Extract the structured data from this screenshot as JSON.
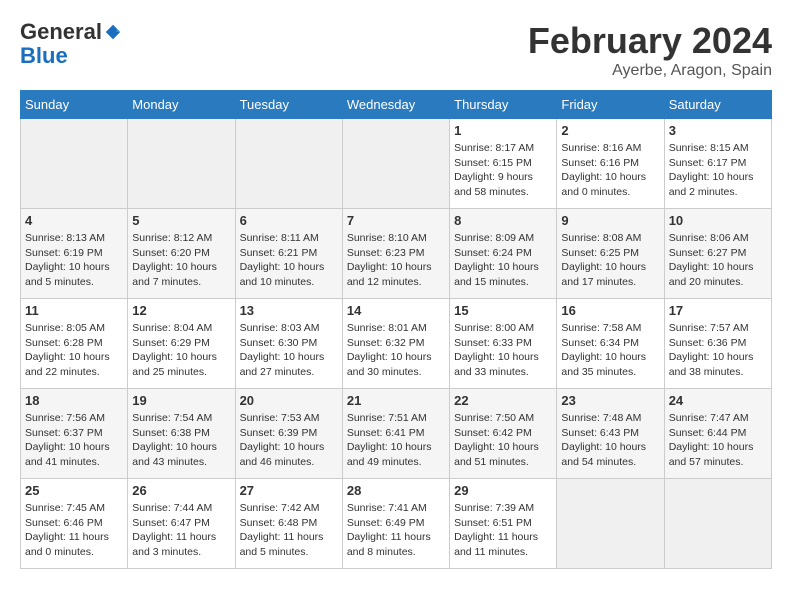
{
  "header": {
    "logo_general": "General",
    "logo_blue": "Blue",
    "month_year": "February 2024",
    "location": "Ayerbe, Aragon, Spain"
  },
  "days_of_week": [
    "Sunday",
    "Monday",
    "Tuesday",
    "Wednesday",
    "Thursday",
    "Friday",
    "Saturday"
  ],
  "weeks": [
    [
      {
        "day": "",
        "info": ""
      },
      {
        "day": "",
        "info": ""
      },
      {
        "day": "",
        "info": ""
      },
      {
        "day": "",
        "info": ""
      },
      {
        "day": "1",
        "info": "Sunrise: 8:17 AM\nSunset: 6:15 PM\nDaylight: 9 hours\nand 58 minutes."
      },
      {
        "day": "2",
        "info": "Sunrise: 8:16 AM\nSunset: 6:16 PM\nDaylight: 10 hours\nand 0 minutes."
      },
      {
        "day": "3",
        "info": "Sunrise: 8:15 AM\nSunset: 6:17 PM\nDaylight: 10 hours\nand 2 minutes."
      }
    ],
    [
      {
        "day": "4",
        "info": "Sunrise: 8:13 AM\nSunset: 6:19 PM\nDaylight: 10 hours\nand 5 minutes."
      },
      {
        "day": "5",
        "info": "Sunrise: 8:12 AM\nSunset: 6:20 PM\nDaylight: 10 hours\nand 7 minutes."
      },
      {
        "day": "6",
        "info": "Sunrise: 8:11 AM\nSunset: 6:21 PM\nDaylight: 10 hours\nand 10 minutes."
      },
      {
        "day": "7",
        "info": "Sunrise: 8:10 AM\nSunset: 6:23 PM\nDaylight: 10 hours\nand 12 minutes."
      },
      {
        "day": "8",
        "info": "Sunrise: 8:09 AM\nSunset: 6:24 PM\nDaylight: 10 hours\nand 15 minutes."
      },
      {
        "day": "9",
        "info": "Sunrise: 8:08 AM\nSunset: 6:25 PM\nDaylight: 10 hours\nand 17 minutes."
      },
      {
        "day": "10",
        "info": "Sunrise: 8:06 AM\nSunset: 6:27 PM\nDaylight: 10 hours\nand 20 minutes."
      }
    ],
    [
      {
        "day": "11",
        "info": "Sunrise: 8:05 AM\nSunset: 6:28 PM\nDaylight: 10 hours\nand 22 minutes."
      },
      {
        "day": "12",
        "info": "Sunrise: 8:04 AM\nSunset: 6:29 PM\nDaylight: 10 hours\nand 25 minutes."
      },
      {
        "day": "13",
        "info": "Sunrise: 8:03 AM\nSunset: 6:30 PM\nDaylight: 10 hours\nand 27 minutes."
      },
      {
        "day": "14",
        "info": "Sunrise: 8:01 AM\nSunset: 6:32 PM\nDaylight: 10 hours\nand 30 minutes."
      },
      {
        "day": "15",
        "info": "Sunrise: 8:00 AM\nSunset: 6:33 PM\nDaylight: 10 hours\nand 33 minutes."
      },
      {
        "day": "16",
        "info": "Sunrise: 7:58 AM\nSunset: 6:34 PM\nDaylight: 10 hours\nand 35 minutes."
      },
      {
        "day": "17",
        "info": "Sunrise: 7:57 AM\nSunset: 6:36 PM\nDaylight: 10 hours\nand 38 minutes."
      }
    ],
    [
      {
        "day": "18",
        "info": "Sunrise: 7:56 AM\nSunset: 6:37 PM\nDaylight: 10 hours\nand 41 minutes."
      },
      {
        "day": "19",
        "info": "Sunrise: 7:54 AM\nSunset: 6:38 PM\nDaylight: 10 hours\nand 43 minutes."
      },
      {
        "day": "20",
        "info": "Sunrise: 7:53 AM\nSunset: 6:39 PM\nDaylight: 10 hours\nand 46 minutes."
      },
      {
        "day": "21",
        "info": "Sunrise: 7:51 AM\nSunset: 6:41 PM\nDaylight: 10 hours\nand 49 minutes."
      },
      {
        "day": "22",
        "info": "Sunrise: 7:50 AM\nSunset: 6:42 PM\nDaylight: 10 hours\nand 51 minutes."
      },
      {
        "day": "23",
        "info": "Sunrise: 7:48 AM\nSunset: 6:43 PM\nDaylight: 10 hours\nand 54 minutes."
      },
      {
        "day": "24",
        "info": "Sunrise: 7:47 AM\nSunset: 6:44 PM\nDaylight: 10 hours\nand 57 minutes."
      }
    ],
    [
      {
        "day": "25",
        "info": "Sunrise: 7:45 AM\nSunset: 6:46 PM\nDaylight: 11 hours\nand 0 minutes."
      },
      {
        "day": "26",
        "info": "Sunrise: 7:44 AM\nSunset: 6:47 PM\nDaylight: 11 hours\nand 3 minutes."
      },
      {
        "day": "27",
        "info": "Sunrise: 7:42 AM\nSunset: 6:48 PM\nDaylight: 11 hours\nand 5 minutes."
      },
      {
        "day": "28",
        "info": "Sunrise: 7:41 AM\nSunset: 6:49 PM\nDaylight: 11 hours\nand 8 minutes."
      },
      {
        "day": "29",
        "info": "Sunrise: 7:39 AM\nSunset: 6:51 PM\nDaylight: 11 hours\nand 11 minutes."
      },
      {
        "day": "",
        "info": ""
      },
      {
        "day": "",
        "info": ""
      }
    ]
  ]
}
